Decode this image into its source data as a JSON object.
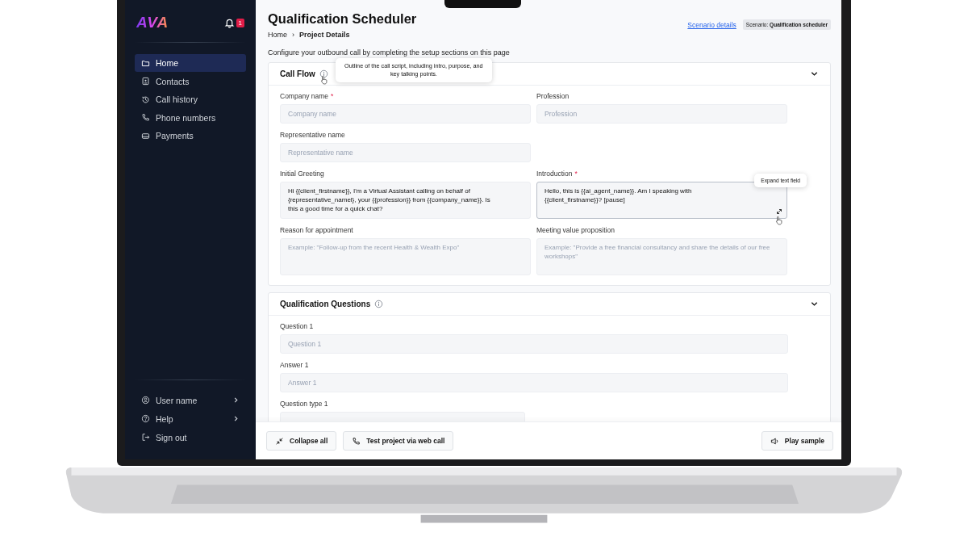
{
  "sidebar": {
    "logo": "AVA",
    "notification_count": "1",
    "nav": [
      {
        "label": "Home",
        "kind": "folder",
        "selected": true
      },
      {
        "label": "Contacts",
        "kind": "contact",
        "selected": false
      },
      {
        "label": "Call history",
        "kind": "history",
        "selected": false
      },
      {
        "label": "Phone numbers",
        "kind": "phone",
        "selected": false
      },
      {
        "label": "Payments",
        "kind": "card",
        "selected": false
      }
    ],
    "footer": [
      {
        "label": "User name",
        "kind": "user",
        "submenu": true
      },
      {
        "label": "Help",
        "kind": "help",
        "submenu": true
      },
      {
        "label": "Sign out",
        "kind": "signout",
        "submenu": false
      }
    ]
  },
  "header": {
    "title": "Qualification Scheduler",
    "breadcrumb": [
      "Home",
      "Project Details"
    ],
    "breadcrumb_separator": "›",
    "scenario_link": "Scenario details",
    "scenario_badge": "Scenario: **Qualification scheduler**"
  },
  "intro": "Configure your outbound call by completing the setup sections on this page",
  "sections": [
    {
      "title": "Call Flow",
      "expanded": true,
      "tooltip": "Outline of the call script, including intro, purpose, and key talking points.",
      "rows": [
        [
          {
            "kind": "input",
            "label": "Company name",
            "required_mark": "*",
            "placeholder": "Company name"
          },
          {
            "kind": "input",
            "label": "Profession",
            "placeholder": "Profession"
          }
        ],
        [
          {
            "kind": "input",
            "label": "Representative name",
            "placeholder": "Representative name"
          }
        ],
        [
          {
            "kind": "textarea",
            "label": "Initial Greeting",
            "focused": false,
            "value": "Hi {{client_firstname}}, I'm a Virtual Assistant calling on behalf of\n{representative_namel}, your {{profession}} from {{company_name}}. Is\nthis a good time for a quick chat?"
          },
          {
            "kind": "textarea",
            "label": "Introduction",
            "required_mark": "*",
            "focused": true,
            "value": "Hello, this is {{ai_agent_name}}. Am I speaking with\n{{client_firstname}}? [pause]",
            "tooltip": "Expand text field"
          }
        ],
        [
          {
            "kind": "textarea",
            "label": "Reason for appointment",
            "focused": false,
            "placeholder": "Example: \"Follow-up from the recent Health & Wealth Expo\""
          },
          {
            "kind": "textarea",
            "label": "Meeting value proposition",
            "focused": false,
            "placeholder": "Example: \"Provide a free financial consultancy and share the details of our free workshops\""
          }
        ]
      ]
    },
    {
      "title": "Qualification Questions",
      "expanded": true,
      "rows": [
        [
          {
            "kind": "long-input",
            "label": "Question 1",
            "placeholder": "Question 1"
          }
        ],
        [
          {
            "kind": "long-input",
            "label": "Answer 1",
            "placeholder": "Answer 1"
          }
        ],
        [
          {
            "kind": "select",
            "label": "Question type 1"
          }
        ]
      ]
    }
  ],
  "actions_left": [
    {
      "label": "Collapse all",
      "kind": "collapse"
    },
    {
      "label": "Test project via web call",
      "kind": "phone"
    }
  ],
  "actions_right": [
    {
      "label": "Play sample",
      "kind": "speaker"
    }
  ]
}
